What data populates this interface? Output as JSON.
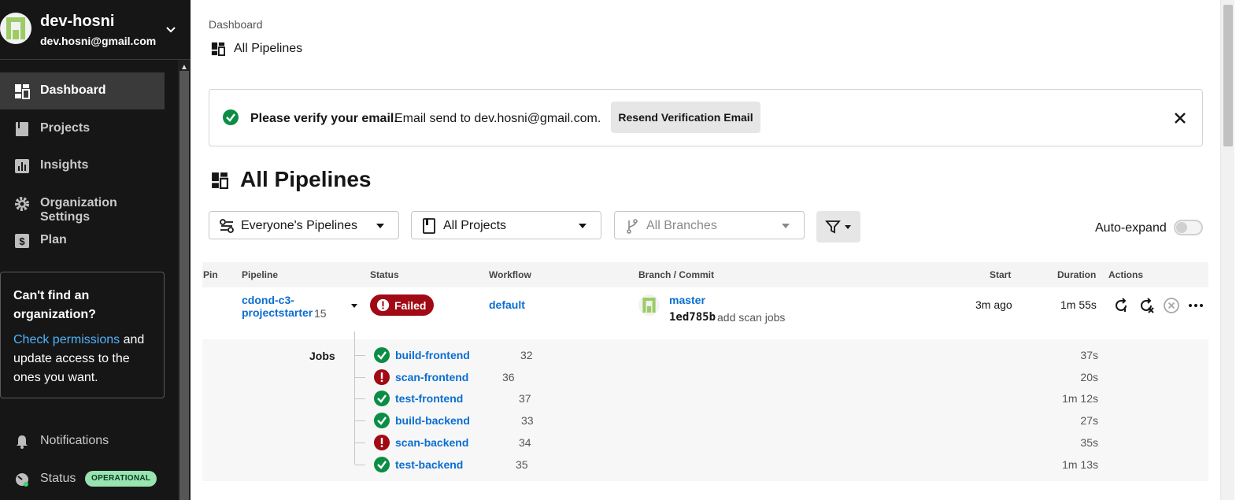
{
  "user": {
    "name": "dev-hosni",
    "email": "dev.hosni@gmail.com"
  },
  "sidebar": {
    "items": [
      {
        "label": "Dashboard",
        "icon": "dashboard-icon",
        "active": true
      },
      {
        "label": "Projects",
        "icon": "book-icon"
      },
      {
        "label": "Insights",
        "icon": "bar-chart-icon"
      },
      {
        "label": "Organization Settings",
        "icon": "gear-icon"
      },
      {
        "label": "Plan",
        "icon": "dollar-icon"
      }
    ],
    "org_card": {
      "title": "Can't find an organization?",
      "link": "Check permissions",
      "text": " and update access to the ones you want."
    },
    "notifications": "Notifications",
    "status": "Status",
    "status_badge": "OPERATIONAL"
  },
  "breadcrumb": "Dashboard",
  "page_sub": "All Pipelines",
  "banner": {
    "bold": "Please verify your email.",
    "message": "Email send to dev.hosni@gmail.com.",
    "resend": "Resend Verification Email"
  },
  "title": "All Pipelines",
  "filters": {
    "pipelines": "Everyone's Pipelines",
    "projects": "All Projects",
    "branches": "All Branches",
    "auto_expand": "Auto-expand"
  },
  "table": {
    "headers": {
      "pin": "Pin",
      "pipeline": "Pipeline",
      "status": "Status",
      "workflow": "Workflow",
      "branch_commit": "Branch / Commit",
      "start": "Start",
      "duration": "Duration",
      "actions": "Actions"
    },
    "row": {
      "pipeline": "cdond-c3-projectstarter",
      "number": "15",
      "status": "Failed",
      "workflow": "default",
      "branch": "master",
      "sha": "1ed785b",
      "commit_msg": "add scan jobs",
      "start": "3m ago",
      "duration": "1m 55s"
    }
  },
  "jobs": {
    "label": "Jobs",
    "items": [
      {
        "name": "build-frontend",
        "num": "32",
        "status": "success",
        "duration": "37s"
      },
      {
        "name": "scan-frontend",
        "num": "36",
        "status": "failed",
        "duration": "20s"
      },
      {
        "name": "test-frontend",
        "num": "37",
        "status": "success",
        "duration": "1m 12s"
      },
      {
        "name": "build-backend",
        "num": "33",
        "status": "success",
        "duration": "27s"
      },
      {
        "name": "scan-backend",
        "num": "34",
        "status": "failed",
        "duration": "35s"
      },
      {
        "name": "test-backend",
        "num": "35",
        "status": "success",
        "duration": "1m 13s"
      }
    ]
  },
  "colors": {
    "success": "#0c8d45",
    "failed": "#a00a15",
    "link": "#0a6ed1",
    "sidebar": "#161616"
  }
}
